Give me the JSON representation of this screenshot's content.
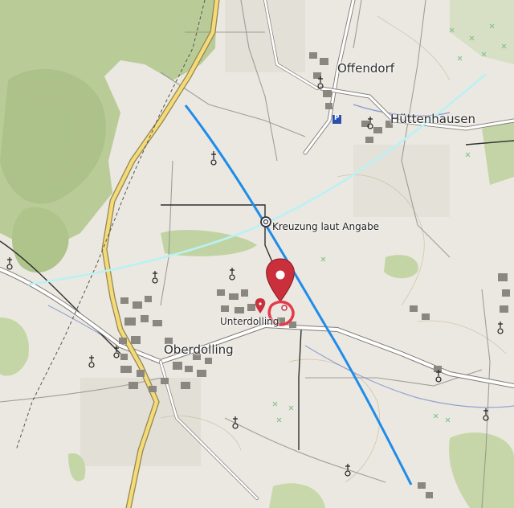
{
  "map": {
    "type": "topographic",
    "places": {
      "offendorf": "Offendorf",
      "huttenhausen": "Hüttenhausen",
      "oberdolling": "Oberdolling",
      "unterdolling": "Unterdolling",
      "kreuzung": "Kreuzung laut Angabe"
    },
    "parking_label": "P",
    "colors": {
      "forest": "#b8cc98",
      "forest_dark": "#a7bf85",
      "field": "#ede9e1",
      "road_major": "#f6dc7a",
      "road_outline": "#9a8f5a",
      "line_blue": "#1f8ce8",
      "line_cyan": "#b8f2f5",
      "marker": "#c9303b",
      "water": "#6d86c8"
    },
    "icons": [
      "church-icon",
      "map-pin-icon",
      "parking-icon",
      "marker-circle-icon"
    ]
  }
}
